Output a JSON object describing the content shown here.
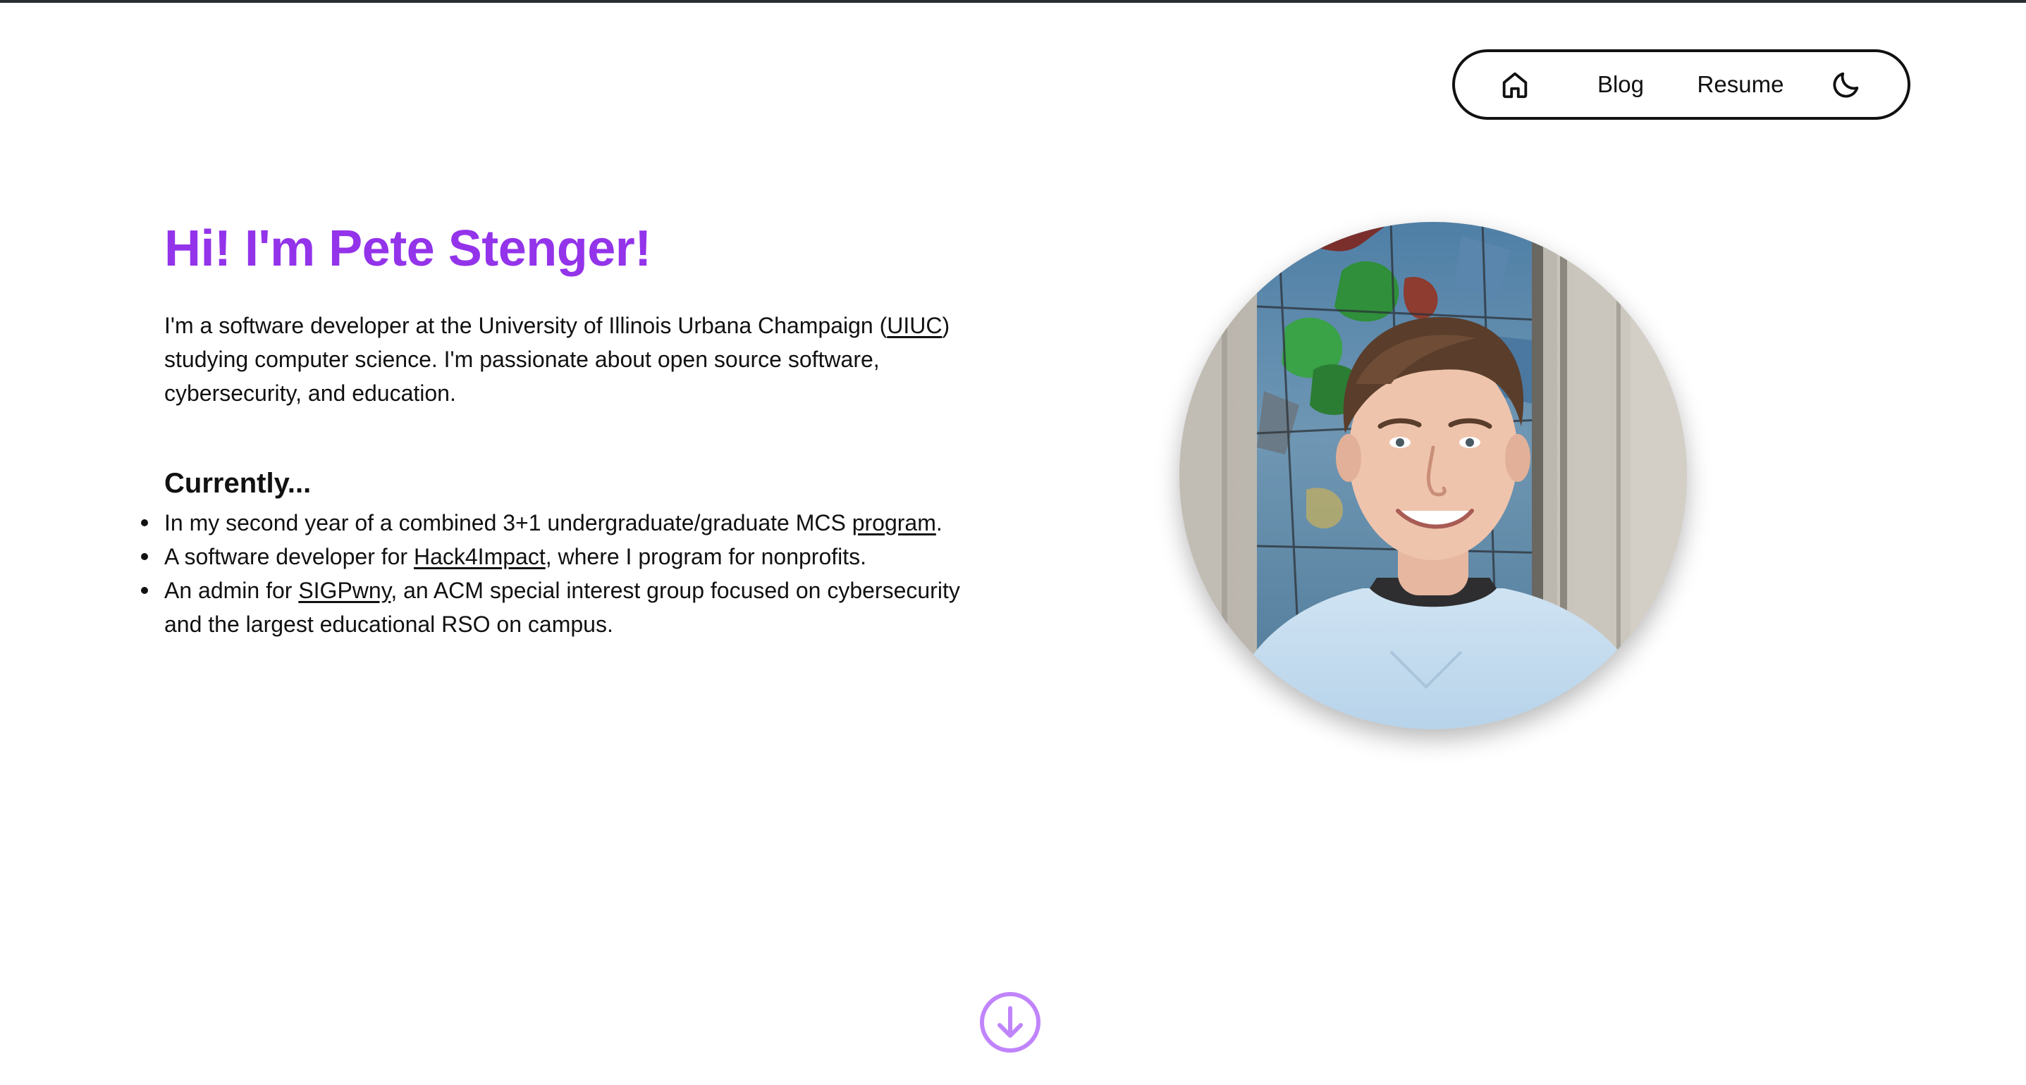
{
  "nav": {
    "home_icon": "home-icon",
    "blog_label": "Blog",
    "resume_label": "Resume",
    "theme_icon": "moon-icon"
  },
  "hero": {
    "title": "Hi! I'm Pete Stenger!",
    "intro_line1_before": "I'm a software developer at the University of Illinois Urbana Champaign (",
    "intro_link_uiuc": "UIUC",
    "intro_line1_after": ")",
    "intro_line2": "studying computer science. I'm passionate about open source software,",
    "intro_line3": "cybersecurity, and education."
  },
  "currently": {
    "heading": "Currently...",
    "items": [
      {
        "before": "In my second year of a combined 3+1 undergraduate/graduate MCS ",
        "link": "program",
        "after": "."
      },
      {
        "before": "A software developer for ",
        "link": "Hack4Impact",
        "after": ", where I program for nonprofits."
      },
      {
        "before": "An admin for ",
        "link": "SIGPwny",
        "after": ", an ACM special interest group focused on cybersecurity",
        "line2": "and the largest educational RSO on campus."
      }
    ]
  },
  "portrait": {
    "subject": "photo of Pete Stenger in front of a stained glass window"
  },
  "scroll_button": {
    "icon": "arrow-down-circle-icon"
  },
  "colors": {
    "accent": "#9333ea",
    "scroll_icon": "#c084fc",
    "text": "#111111",
    "background": "#ffffff"
  }
}
